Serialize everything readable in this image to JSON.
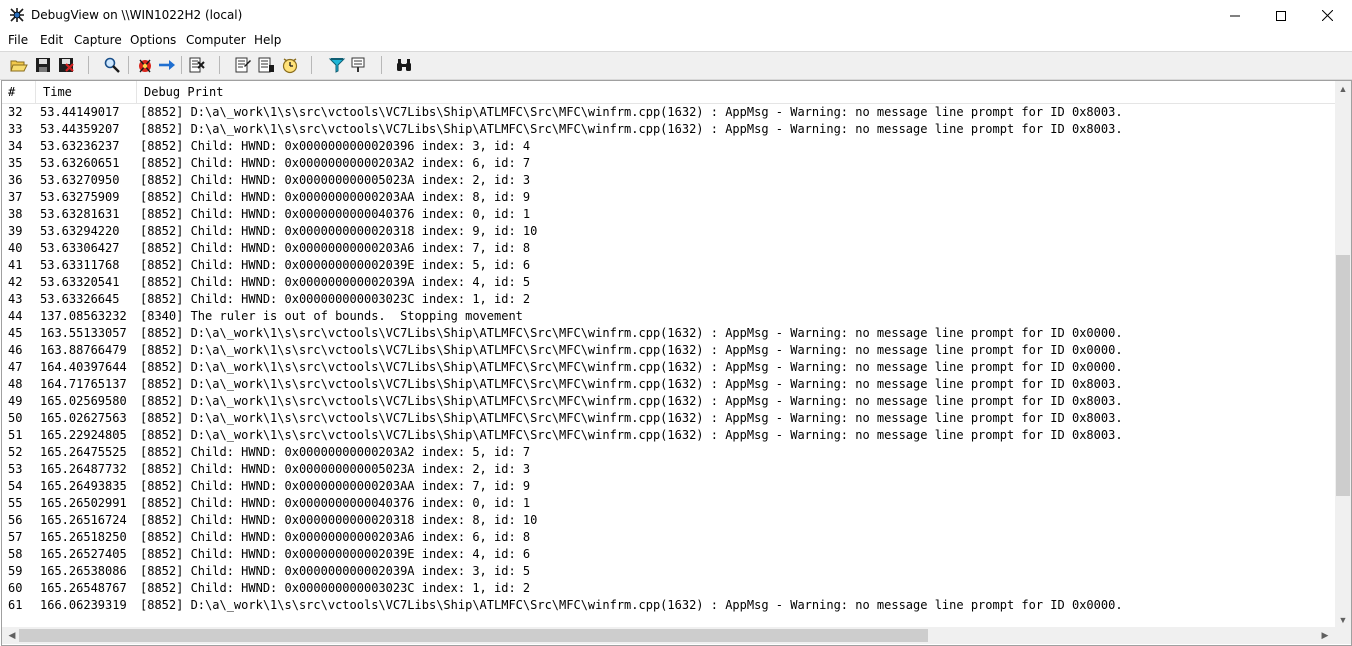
{
  "window": {
    "title": "DebugView on \\\\WIN1022H2 (local)",
    "minimize_label": "—",
    "maximize_label": "☐",
    "close_label": "✕"
  },
  "menu": {
    "items": [
      "File",
      "Edit",
      "Capture",
      "Options",
      "Computer",
      "Help"
    ]
  },
  "toolbar": {
    "buttons": [
      "open-icon",
      "save-icon",
      "clear-display-icon",
      "find-icon",
      "capture-icon",
      "autoscroll-icon",
      "clear-icon",
      "filter-icon",
      "highlight-icon",
      "clock-time-icon",
      "filter-down-icon",
      "history-icon",
      "binoculars-icon"
    ]
  },
  "log": {
    "columns": [
      "#",
      "Time",
      "Debug Print"
    ],
    "scroll": {
      "vertical_position": 0.49,
      "vertical_size": 0.47,
      "horizontal_position": 0.0,
      "horizontal_size": 0.7
    },
    "rows": [
      {
        "num": "32",
        "time": "53.44149017",
        "msg": "[8852] D:\\a\\_work\\1\\s\\src\\vctools\\VC7Libs\\Ship\\ATLMFC\\Src\\MFC\\winfrm.cpp(1632) : AppMsg - Warning: no message line prompt for ID 0x8003."
      },
      {
        "num": "33",
        "time": "53.44359207",
        "msg": "[8852] D:\\a\\_work\\1\\s\\src\\vctools\\VC7Libs\\Ship\\ATLMFC\\Src\\MFC\\winfrm.cpp(1632) : AppMsg - Warning: no message line prompt for ID 0x8003."
      },
      {
        "num": "34",
        "time": "53.63236237",
        "msg": "[8852] Child: HWND: 0x0000000000020396 index: 3, id: 4"
      },
      {
        "num": "35",
        "time": "53.63260651",
        "msg": "[8852] Child: HWND: 0x00000000000203A2 index: 6, id: 7"
      },
      {
        "num": "36",
        "time": "53.63270950",
        "msg": "[8852] Child: HWND: 0x000000000005023A index: 2, id: 3"
      },
      {
        "num": "37",
        "time": "53.63275909",
        "msg": "[8852] Child: HWND: 0x00000000000203AA index: 8, id: 9"
      },
      {
        "num": "38",
        "time": "53.63281631",
        "msg": "[8852] Child: HWND: 0x0000000000040376 index: 0, id: 1"
      },
      {
        "num": "39",
        "time": "53.63294220",
        "msg": "[8852] Child: HWND: 0x0000000000020318 index: 9, id: 10"
      },
      {
        "num": "40",
        "time": "53.63306427",
        "msg": "[8852] Child: HWND: 0x00000000000203A6 index: 7, id: 8"
      },
      {
        "num": "41",
        "time": "53.63311768",
        "msg": "[8852] Child: HWND: 0x000000000002039E index: 5, id: 6"
      },
      {
        "num": "42",
        "time": "53.63320541",
        "msg": "[8852] Child: HWND: 0x000000000002039A index: 4, id: 5"
      },
      {
        "num": "43",
        "time": "53.63326645",
        "msg": "[8852] Child: HWND: 0x000000000003023C index: 1, id: 2"
      },
      {
        "num": "44",
        "time": "137.08563232",
        "msg": "[8340] The ruler is out of bounds.  Stopping movement"
      },
      {
        "num": "45",
        "time": "163.55133057",
        "msg": "[8852] D:\\a\\_work\\1\\s\\src\\vctools\\VC7Libs\\Ship\\ATLMFC\\Src\\MFC\\winfrm.cpp(1632) : AppMsg - Warning: no message line prompt for ID 0x0000."
      },
      {
        "num": "46",
        "time": "163.88766479",
        "msg": "[8852] D:\\a\\_work\\1\\s\\src\\vctools\\VC7Libs\\Ship\\ATLMFC\\Src\\MFC\\winfrm.cpp(1632) : AppMsg - Warning: no message line prompt for ID 0x0000."
      },
      {
        "num": "47",
        "time": "164.40397644",
        "msg": "[8852] D:\\a\\_work\\1\\s\\src\\vctools\\VC7Libs\\Ship\\ATLMFC\\Src\\MFC\\winfrm.cpp(1632) : AppMsg - Warning: no message line prompt for ID 0x0000."
      },
      {
        "num": "48",
        "time": "164.71765137",
        "msg": "[8852] D:\\a\\_work\\1\\s\\src\\vctools\\VC7Libs\\Ship\\ATLMFC\\Src\\MFC\\winfrm.cpp(1632) : AppMsg - Warning: no message line prompt for ID 0x8003."
      },
      {
        "num": "49",
        "time": "165.02569580",
        "msg": "[8852] D:\\a\\_work\\1\\s\\src\\vctools\\VC7Libs\\Ship\\ATLMFC\\Src\\MFC\\winfrm.cpp(1632) : AppMsg - Warning: no message line prompt for ID 0x8003."
      },
      {
        "num": "50",
        "time": "165.02627563",
        "msg": "[8852] D:\\a\\_work\\1\\s\\src\\vctools\\VC7Libs\\Ship\\ATLMFC\\Src\\MFC\\winfrm.cpp(1632) : AppMsg - Warning: no message line prompt for ID 0x8003."
      },
      {
        "num": "51",
        "time": "165.22924805",
        "msg": "[8852] D:\\a\\_work\\1\\s\\src\\vctools\\VC7Libs\\Ship\\ATLMFC\\Src\\MFC\\winfrm.cpp(1632) : AppMsg - Warning: no message line prompt for ID 0x8003."
      },
      {
        "num": "52",
        "time": "165.26475525",
        "msg": "[8852] Child: HWND: 0x00000000000203A2 index: 5, id: 7"
      },
      {
        "num": "53",
        "time": "165.26487732",
        "msg": "[8852] Child: HWND: 0x000000000005023A index: 2, id: 3"
      },
      {
        "num": "54",
        "time": "165.26493835",
        "msg": "[8852] Child: HWND: 0x00000000000203AA index: 7, id: 9"
      },
      {
        "num": "55",
        "time": "165.26502991",
        "msg": "[8852] Child: HWND: 0x0000000000040376 index: 0, id: 1"
      },
      {
        "num": "56",
        "time": "165.26516724",
        "msg": "[8852] Child: HWND: 0x0000000000020318 index: 8, id: 10"
      },
      {
        "num": "57",
        "time": "165.26518250",
        "msg": "[8852] Child: HWND: 0x00000000000203A6 index: 6, id: 8"
      },
      {
        "num": "58",
        "time": "165.26527405",
        "msg": "[8852] Child: HWND: 0x000000000002039E index: 4, id: 6"
      },
      {
        "num": "59",
        "time": "165.26538086",
        "msg": "[8852] Child: HWND: 0x000000000002039A index: 3, id: 5"
      },
      {
        "num": "60",
        "time": "165.26548767",
        "msg": "[8852] Child: HWND: 0x000000000003023C index: 1, id: 2"
      },
      {
        "num": "61",
        "time": "166.06239319",
        "msg": "[8852] D:\\a\\_work\\1\\s\\src\\vctools\\VC7Libs\\Ship\\ATLMFC\\Src\\MFC\\winfrm.cpp(1632) : AppMsg - Warning: no message line prompt for ID 0x0000."
      }
    ]
  }
}
